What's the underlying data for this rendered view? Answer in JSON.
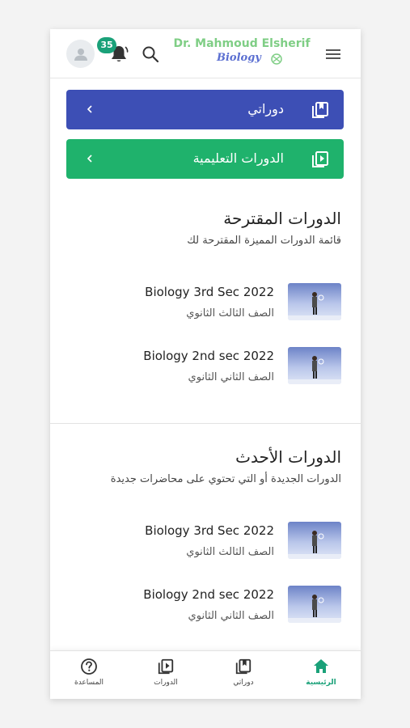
{
  "header": {
    "notification_count": "35",
    "logo_title": "Dr. Mahmoud Elsherif",
    "logo_subtitle": "Biology"
  },
  "nav_buttons": [
    {
      "label": "دوراتي",
      "color": "#3d4fb5"
    },
    {
      "label": "الدورات التعليمية",
      "color": "#1fb26c"
    }
  ],
  "sections": [
    {
      "title": "الدورات المقترحة",
      "subtitle": "قائمة الدورات المميزة المقترحة لك",
      "courses": [
        {
          "name": "Biology 3rd Sec 2022",
          "grade": "الصف الثالث الثانوي"
        },
        {
          "name": "Biology 2nd sec 2022",
          "grade": "الصف الثاني الثانوي"
        }
      ]
    },
    {
      "title": "الدورات الأحدث",
      "subtitle": "الدورات الجديدة أو التي تحتوي على محاضرات جديدة",
      "courses": [
        {
          "name": "Biology 3rd Sec 2022",
          "grade": "الصف الثالث الثانوي"
        },
        {
          "name": "Biology 2nd sec 2022",
          "grade": "الصف الثاني الثانوي"
        }
      ]
    }
  ],
  "bottom_nav": [
    {
      "label": "المساعدة",
      "icon": "help-icon",
      "active": false
    },
    {
      "label": "الدورات",
      "icon": "play-library-icon",
      "active": false
    },
    {
      "label": "دوراتي",
      "icon": "bookmark-library-icon",
      "active": false
    },
    {
      "label": "الرئيسية",
      "icon": "home-icon",
      "active": true
    }
  ],
  "colors": {
    "accent": "#1aa179",
    "primary": "#3d4fb5",
    "green": "#1fb26c"
  }
}
